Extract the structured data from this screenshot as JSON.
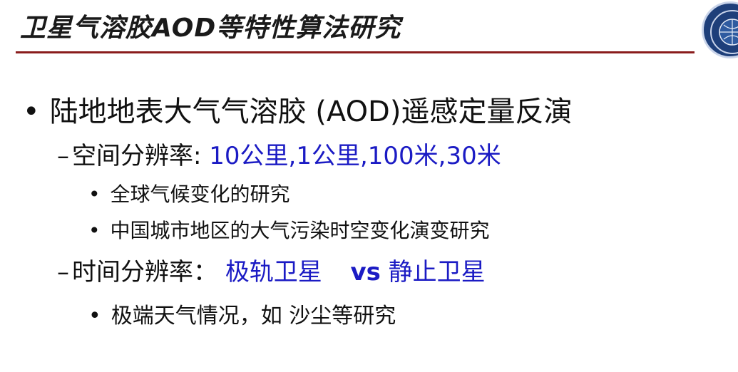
{
  "slide": {
    "title": "卫星气溶胶AOD等特性算法研究",
    "bullets": {
      "main": "陆地地表大气气溶胶 (AOD)遥感定量反演",
      "spatial": {
        "label": "空间分辨率:",
        "value": "10公里,1公里,100米,30米",
        "items": [
          "全球气候变化的研究",
          "中国城市地区的大气污染时空变化演变研究"
        ]
      },
      "temporal": {
        "label": "时间分辨率：",
        "value_a": "极轨卫星",
        "vs": "vs",
        "value_b": "静止卫星",
        "items": [
          "极端天气情况，如 沙尘等研究"
        ]
      }
    },
    "symbols": {
      "bullet": "•",
      "dash": "–"
    },
    "colors": {
      "accent_rule": "#8a1d1d",
      "highlight_text": "#1b1bc4",
      "logo": "#1e3f7a"
    },
    "icons": {
      "logo": "university-seal-icon"
    }
  }
}
